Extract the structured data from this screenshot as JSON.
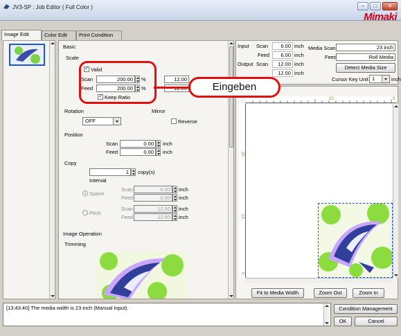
{
  "window": {
    "title": "JV3-SP : Job Editor ( Full Color )",
    "brand": "Mimaki",
    "controls": {
      "minimize": "–",
      "maximize": "□",
      "close": "✕"
    }
  },
  "tabs": [
    {
      "label": "Image Edit",
      "active": true
    },
    {
      "label": "Color Edit",
      "active": false
    },
    {
      "label": "Print Condition",
      "active": false
    }
  ],
  "basic": {
    "heading": "Basic",
    "scale": {
      "heading": "Scale",
      "valid_label": "Valid",
      "valid_checked": true,
      "scan_label": "Scan",
      "scan_value": "200.00",
      "scan_unit": "%",
      "scan_abs": "12.00",
      "feed_label": "Feed",
      "feed_value": "200.00",
      "feed_unit": "%",
      "feed_abs": "12.00",
      "keep_ratio_label": "Keep Ratio",
      "keep_ratio_checked": true
    },
    "rotation": {
      "heading": "Rotation",
      "value": "OFF"
    },
    "mirror": {
      "heading": "Mirror",
      "reverse_label": "Reverse",
      "reverse_checked": false
    },
    "position": {
      "heading": "Position",
      "scan_label": "Scan",
      "scan_value": "0.00",
      "scan_unit": "inch",
      "feed_label": "Feed",
      "feed_value": "0.00",
      "feed_unit": "inch"
    },
    "copy": {
      "heading": "Copy",
      "count": "1",
      "count_unit": "copy(s)",
      "interval_label": "Interval",
      "space_label": "Space",
      "space_scan_label": "Scan",
      "space_scan_value": "0.00",
      "space_scan_unit": "inch",
      "space_feed_label": "Feed",
      "space_feed_value": "0.00",
      "space_feed_unit": "inch",
      "pitch_label": "Pitch",
      "pitch_scan_label": "Scan",
      "pitch_scan_value": "12.00",
      "pitch_scan_unit": "inch",
      "pitch_feed_label": "Feed",
      "pitch_feed_value": "12.00",
      "pitch_feed_unit": "inch"
    },
    "image_operation": {
      "heading": "Image Operation",
      "trimming_label": "Trimming"
    }
  },
  "info": {
    "input_label": "Input",
    "input_scan_label": "Scan",
    "input_scan_value": "6.00",
    "input_scan_unit": "inch",
    "input_feed_label": "Feed",
    "input_feed_value": "6.00",
    "input_feed_unit": "inch",
    "output_label": "Output",
    "output_scan_label": "Scan",
    "output_scan_value": "12.00",
    "output_scan_unit": "inch",
    "output_feed_value": "12.00",
    "output_feed_unit": "inch",
    "media_scan_label": "Media Scan",
    "media_scan_value": "23 inch",
    "media_feed_label": "Feed",
    "media_feed_value": "Roll Media",
    "detect_button": "Detect Media Size",
    "cursor_key_label": "Cursor Key Unit",
    "cursor_key_value": "1",
    "cursor_key_unit": "inch"
  },
  "ruler": {
    "top_ticks": [
      "10",
      "0"
    ],
    "side_ticks": [
      "20",
      "10",
      "0"
    ]
  },
  "preview_buttons": {
    "fit": "Fit to Media Width",
    "zoom_out": "Zoom Out",
    "zoom_in": "Zoom In"
  },
  "status_message": "[13:43:40] The media width is 23 inch (Manual Input).",
  "footer_buttons": {
    "condition": "Condition Management",
    "ok": "OK",
    "cancel": "Cancel"
  },
  "callout": {
    "text": "Eingeben"
  },
  "colors": {
    "highlight": "#e01010",
    "brand": "#d0021b",
    "selection": "#1a56d6"
  }
}
